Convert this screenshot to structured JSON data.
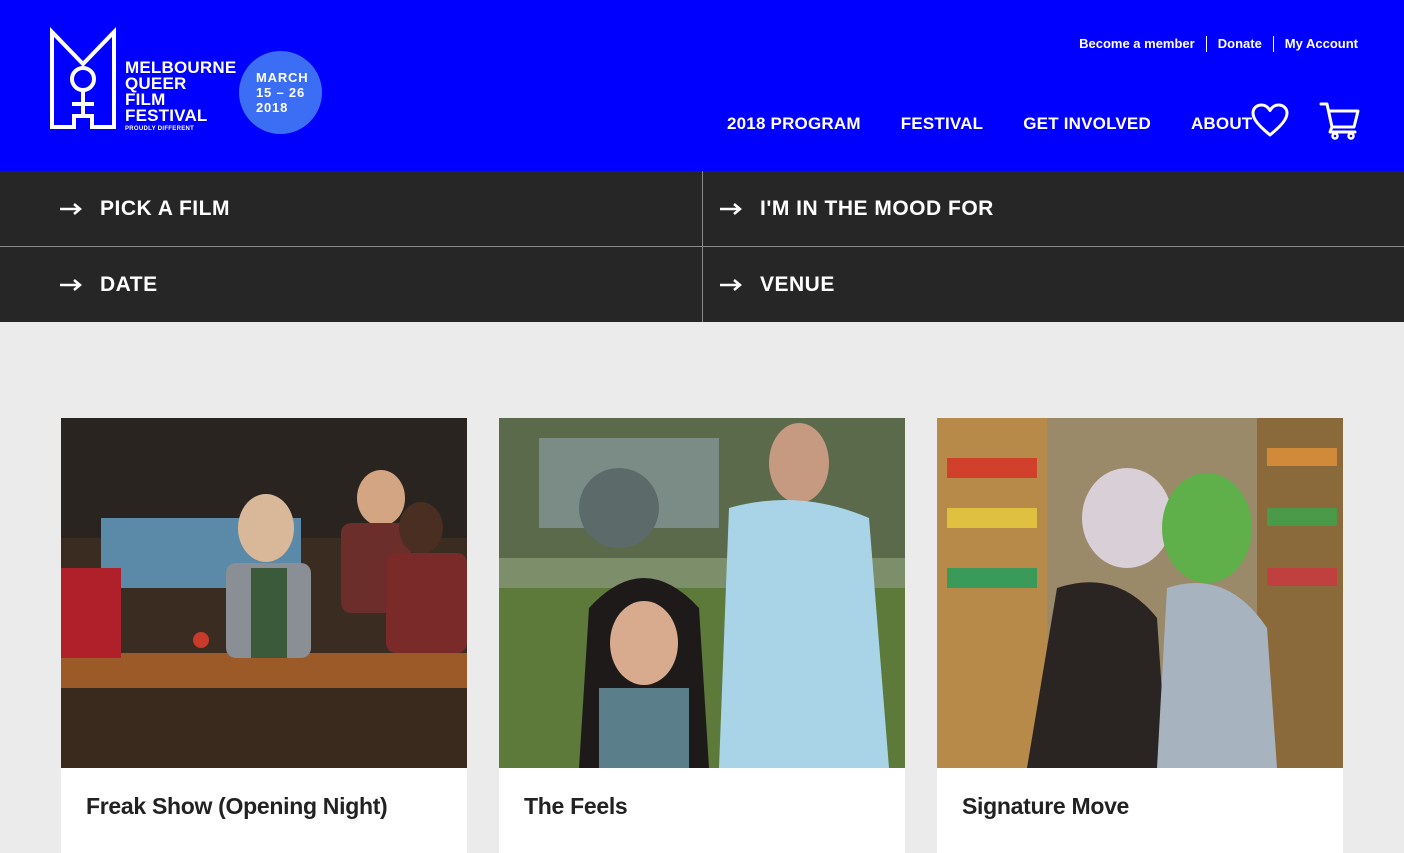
{
  "brand": {
    "logo_lines": [
      "MELBOURNE",
      "QUEER",
      "FILM",
      "FESTIVAL"
    ],
    "tagline": "PROUDLY DIFFERENT",
    "date_badge": [
      "MARCH",
      "15 – 26",
      "2018"
    ],
    "color_primary": "#0000ff",
    "color_badge": "#3b6ef5"
  },
  "utility_nav": [
    "Become a member",
    "Donate",
    "My Account"
  ],
  "main_nav": [
    "2018 PROGRAM",
    "FESTIVAL",
    "GET INVOLVED",
    "ABOUT"
  ],
  "header_icons": [
    "heart-icon",
    "cart-icon"
  ],
  "filters": [
    "PICK A FILM",
    "I'M IN THE MOOD FOR",
    "DATE",
    "VENUE"
  ],
  "films": [
    {
      "title": "Freak Show (Opening Night)"
    },
    {
      "title": "The Feels"
    },
    {
      "title": "Signature Move"
    }
  ]
}
